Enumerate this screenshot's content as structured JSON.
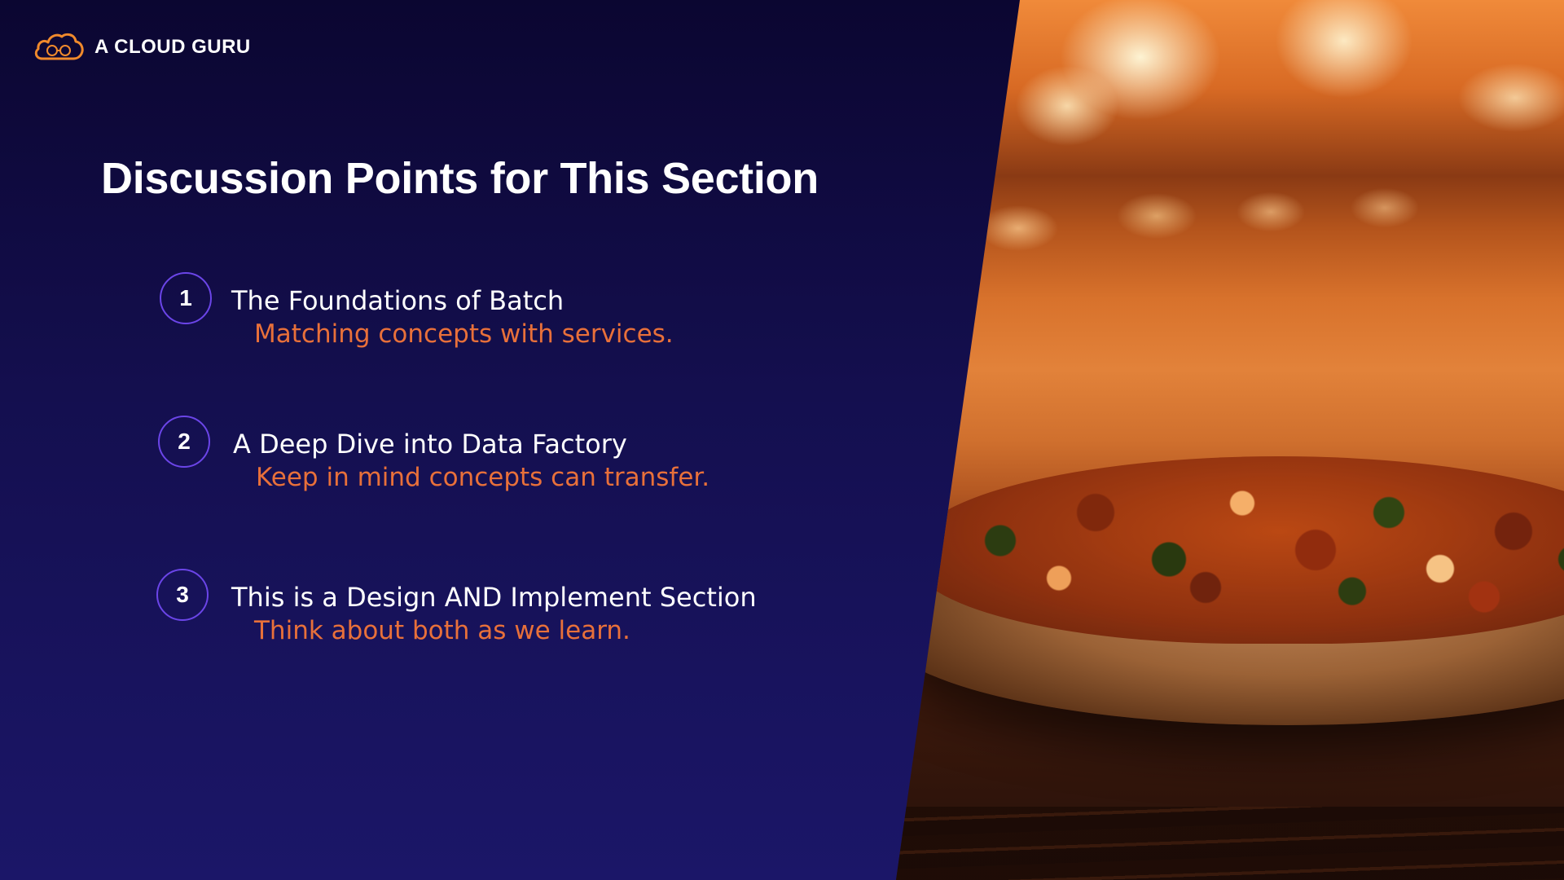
{
  "slide": {
    "brand": {
      "logo_icon": "cloud-logo-icon",
      "name": "A CLOUD GURU"
    },
    "title": "Discussion Points for This Section",
    "points": [
      {
        "number": "1",
        "title": "The Foundations of Batch",
        "subtitle": "Matching concepts with services."
      },
      {
        "number": "2",
        "title": "A Deep Dive into Data Factory",
        "subtitle": "Keep in mind concepts can transfer."
      },
      {
        "number": "3",
        "title": "This is a Design AND Implement Section",
        "subtitle": "Think about both as we learn."
      }
    ],
    "image": {
      "subject": "wood-fired-pizza-photo"
    },
    "colors": {
      "background_top": "#0b0631",
      "background_bottom": "#1b1668",
      "accent_orange": "#e8703a",
      "badge_border": "#6b45e8",
      "title_text": "#ffffff"
    }
  }
}
